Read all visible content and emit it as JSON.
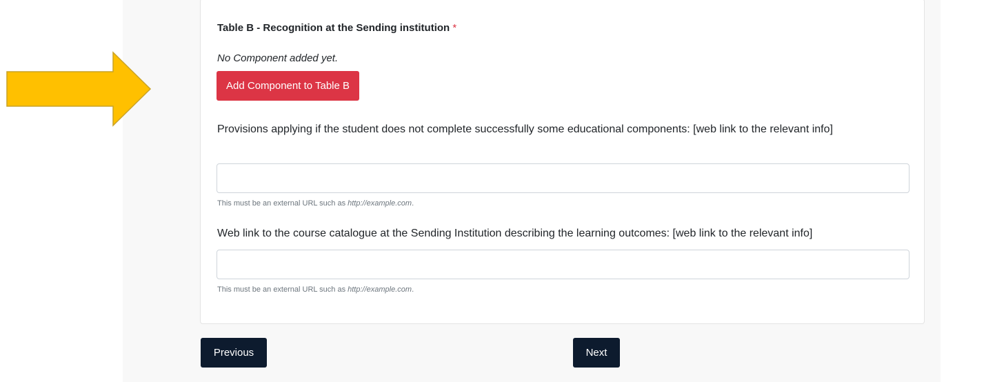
{
  "table_b": {
    "title": "Table B - Recognition at the Sending institution",
    "required_marker": "*",
    "empty_note": "No Component added yet.",
    "add_button_label": "Add Component to Table B"
  },
  "provisions_field": {
    "label": "Provisions applying if the student does not complete successfully some educational components: [web link to the relevant info]",
    "value": "",
    "help_prefix": "This must be an external URL such as ",
    "help_example": "http://example.com",
    "help_suffix": "."
  },
  "catalogue_field": {
    "label": "Web link to the course catalogue at the Sending Institution describing the learning outcomes: [web link to the relevant info]",
    "value": "",
    "help_prefix": "This must be an external URL such as ",
    "help_example": "http://example.com",
    "help_suffix": "."
  },
  "navigation": {
    "previous_label": "Previous",
    "next_label": "Next"
  },
  "colors": {
    "annotation_arrow": "#FFC000",
    "add_button": "#DC3545",
    "nav_button": "#0D1B2E",
    "required_marker": "#DC3545"
  },
  "icons": {
    "annotation": "arrow-right-icon"
  }
}
